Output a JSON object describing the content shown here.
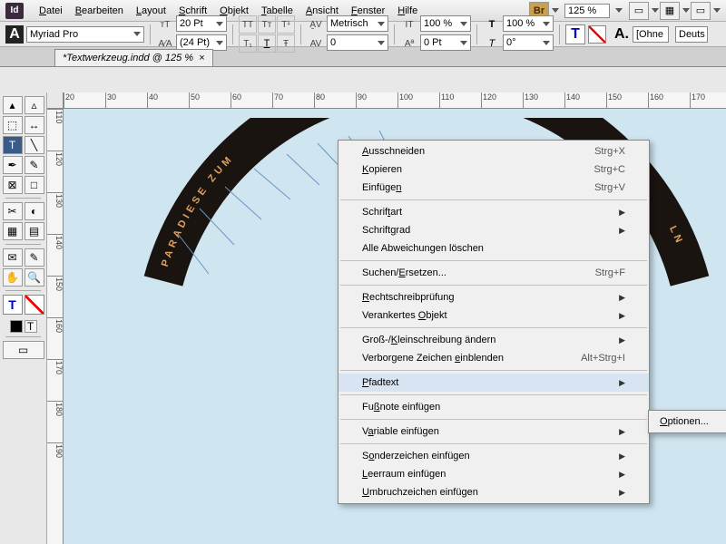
{
  "app": {
    "logo": "Id"
  },
  "menu": {
    "items": [
      "Datei",
      "Bearbeiten",
      "Layout",
      "Schrift",
      "Objekt",
      "Tabelle",
      "Ansicht",
      "Fenster",
      "Hilfe"
    ],
    "zoom": "125 %",
    "br": "Br"
  },
  "toolbar": {
    "font": "Myriad Pro",
    "size1": "20 Pt",
    "size2": "(24 Pt)",
    "metric": "Metrisch",
    "pct1": "100 %",
    "pct2": "100 %",
    "track": "0",
    "baseline": "0 Pt",
    "rot": "0°",
    "lang": "Deuts",
    "ohne": "[Ohne"
  },
  "tab": {
    "title": "*Textwerkzeug.indd @ 125 %"
  },
  "ruler_h": [
    "20",
    "30",
    "40",
    "50",
    "60",
    "70",
    "80",
    "90",
    "100",
    "110",
    "120",
    "130",
    "140",
    "150",
    "160",
    "170"
  ],
  "ruler_v": [
    "110",
    "120",
    "130",
    "140",
    "150",
    "160",
    "170",
    "180",
    "190"
  ],
  "art_text": "PARADIESE ZUM",
  "art_text2": "LN",
  "context": {
    "items": [
      {
        "label": "Ausschneiden",
        "u": 0,
        "shortcut": "Strg+X"
      },
      {
        "label": "Kopieren",
        "u": 0,
        "shortcut": "Strg+C"
      },
      {
        "label": "Einfügen",
        "u": 7,
        "shortcut": "Strg+V"
      },
      {
        "sep": true
      },
      {
        "label": "Schriftart",
        "u": 6,
        "arrow": true
      },
      {
        "label": "Schriftgrad",
        "u": 7,
        "arrow": true
      },
      {
        "label": "Alle Abweichungen löschen"
      },
      {
        "sep": true
      },
      {
        "label": "Suchen/Ersetzen...",
        "u": 7,
        "shortcut": "Strg+F"
      },
      {
        "sep": true
      },
      {
        "label": "Rechtschreibprüfung",
        "u": 0,
        "arrow": true
      },
      {
        "label": "Verankertes Objekt",
        "u": 12,
        "arrow": true
      },
      {
        "sep": true
      },
      {
        "label": "Groß-/Kleinschreibung ändern",
        "u": 6,
        "arrow": true
      },
      {
        "label": "Verborgene Zeichen einblenden",
        "u": 19,
        "shortcut": "Alt+Strg+I"
      },
      {
        "sep": true
      },
      {
        "label": "Pfadtext",
        "u": 0,
        "arrow": true,
        "highlighted": true
      },
      {
        "sep": true
      },
      {
        "label": "Fußnote einfügen",
        "u": 2
      },
      {
        "sep": true
      },
      {
        "label": "Variable einfügen",
        "u": 1,
        "arrow": true
      },
      {
        "sep": true
      },
      {
        "label": "Sonderzeichen einfügen",
        "u": 1,
        "arrow": true
      },
      {
        "label": "Leerraum einfügen",
        "u": 0,
        "arrow": true
      },
      {
        "label": "Umbruchzeichen einfügen",
        "u": 0,
        "arrow": true
      }
    ]
  },
  "submenu": {
    "option": "Optionen..."
  }
}
